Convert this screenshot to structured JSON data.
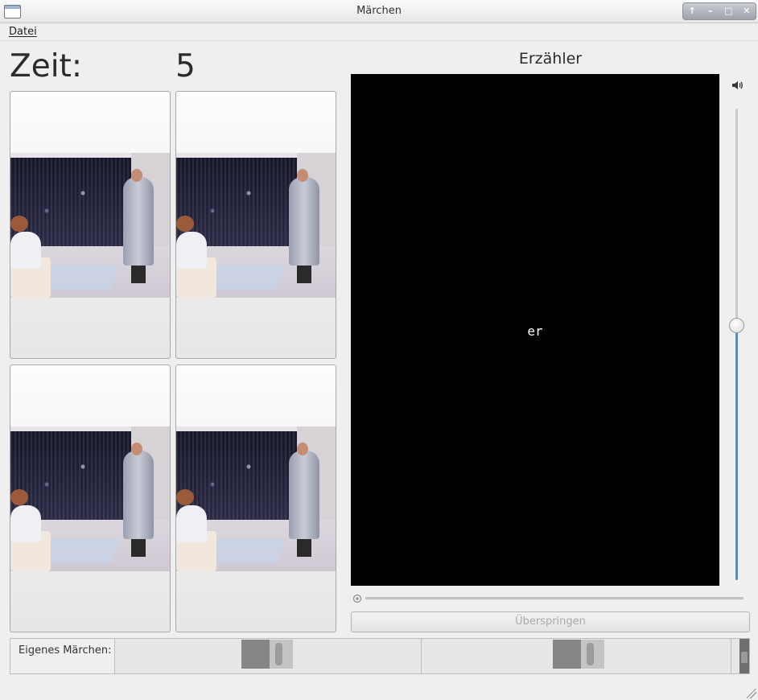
{
  "window": {
    "title": "Märchen"
  },
  "window_buttons": {
    "shade": "↑",
    "minimize": "–",
    "maximize": "□",
    "close": "✕"
  },
  "menu": {
    "items": [
      {
        "label": "Datei"
      }
    ]
  },
  "timer": {
    "label": "Zeit:",
    "value": "5"
  },
  "cards": [
    {
      "id": 1
    },
    {
      "id": 2
    },
    {
      "id": 3
    },
    {
      "id": 4
    }
  ],
  "narrator": {
    "title": "Erzähler",
    "subtitle_text": "er",
    "volume_level": 0.54,
    "seek_position": 0.0,
    "skip_label": "Überspringen"
  },
  "own_tale": {
    "label": "Eigenes Märchen:"
  },
  "icons": {
    "app": "window-app-icon",
    "volume": "speaker-icon",
    "seek": "playhead-icon"
  }
}
